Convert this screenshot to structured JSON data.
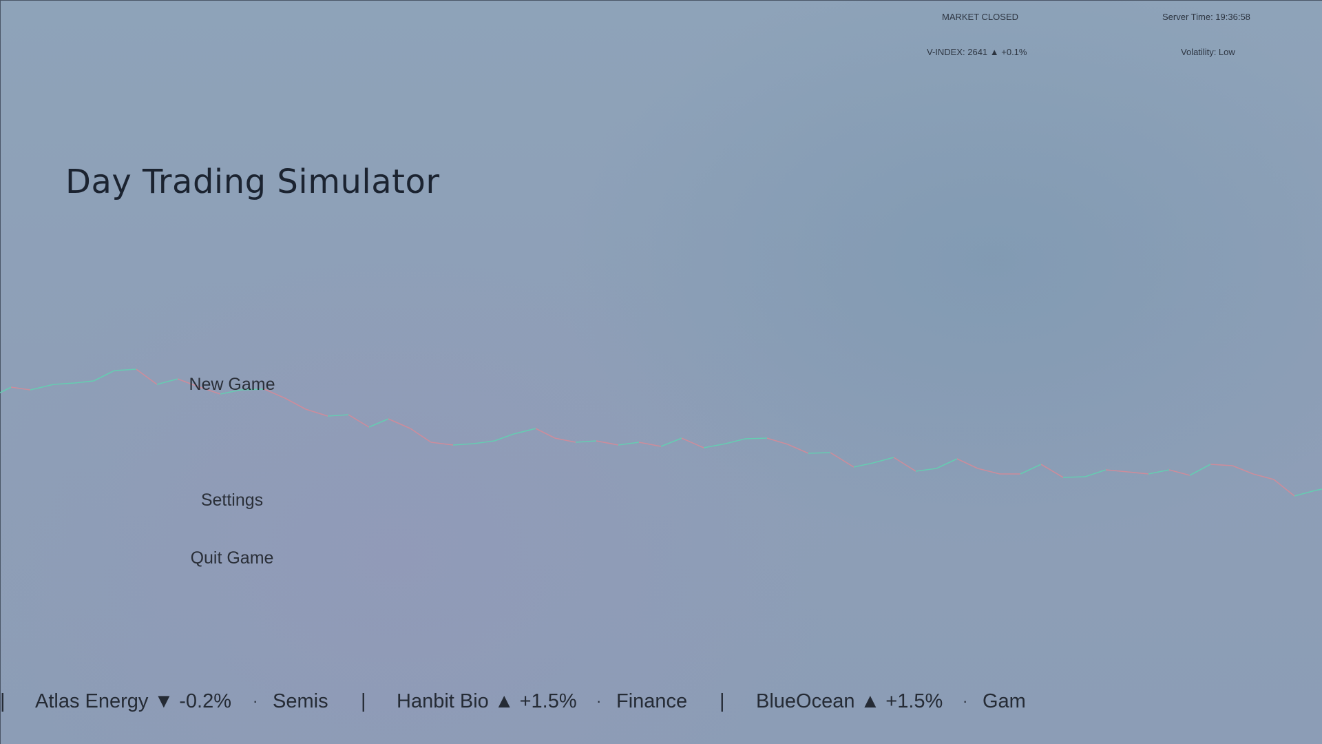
{
  "status": {
    "market": "MARKET CLOSED",
    "server_time": "Server Time: 19:36:58",
    "vindex": "V-INDEX: 2641  ▲ +0.1%",
    "volatility": "Volatility: Low"
  },
  "title": "Day Trading Simulator",
  "menu": {
    "new_game": "New Game",
    "settings": "Settings",
    "quit_game": "Quit Game"
  },
  "ticker": {
    "separator": "|",
    "dot": "·",
    "items": [
      "Atlas Energy ▼ -0.2%",
      "Semis",
      "Hanbit Bio ▲ +1.5%",
      "Finance",
      "BlueOcean ▲ +1.5%",
      "Gam"
    ]
  },
  "colors": {
    "up": "#5fd3b0",
    "down": "#d88a96",
    "text": "#1b2330"
  }
}
